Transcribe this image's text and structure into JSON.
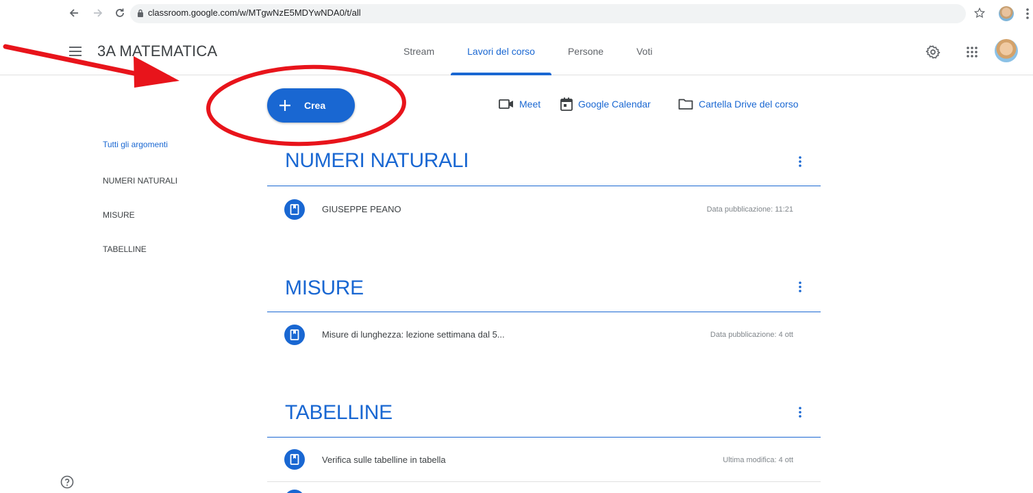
{
  "browser": {
    "url": "classroom.google.com/w/MTgwNzE5MDYwNDA0/t/all"
  },
  "header": {
    "course_title": "3A MATEMATICA",
    "tabs": [
      {
        "label": "Stream",
        "active": false
      },
      {
        "label": "Lavori del corso",
        "active": true
      },
      {
        "label": "Persone",
        "active": false
      },
      {
        "label": "Voti",
        "active": false
      }
    ]
  },
  "toolbar": {
    "create_label": "Crea",
    "meet_label": "Meet",
    "calendar_label": "Google Calendar",
    "drive_label": "Cartella Drive del corso"
  },
  "sidebar": {
    "items": [
      {
        "label": "Tutti gli argomenti",
        "active": true
      },
      {
        "label": "NUMERI NATURALI",
        "active": false
      },
      {
        "label": "MISURE",
        "active": false
      },
      {
        "label": "TABELLINE",
        "active": false
      }
    ]
  },
  "topics": [
    {
      "title": "NUMERI NATURALI",
      "items": [
        {
          "title": "GIUSEPPE PEANO",
          "date": "Data pubblicazione: 11:21"
        }
      ]
    },
    {
      "title": "MISURE",
      "items": [
        {
          "title": "Misure di lunghezza: lezione settimana dal 5...",
          "date": "Data pubblicazione: 4 ott"
        }
      ]
    },
    {
      "title": "TABELLINE",
      "items": [
        {
          "title": "Verifica sulle tabelline in tabella",
          "date": "Ultima modifica: 4 ott"
        }
      ]
    }
  ],
  "icons": {
    "back": "arrow-left-icon",
    "forward": "arrow-right-icon",
    "reload": "reload-icon",
    "lock": "lock-icon",
    "star": "star-icon",
    "menu": "hamburger-icon",
    "settings": "gear-icon",
    "apps": "apps-grid-icon",
    "help": "help-icon",
    "assignment": "assignment-icon",
    "more": "more-vert-icon"
  },
  "colors": {
    "accent": "#1967d2",
    "annotation": "#e8141b",
    "text": "#3c4043",
    "muted": "#80868b"
  }
}
